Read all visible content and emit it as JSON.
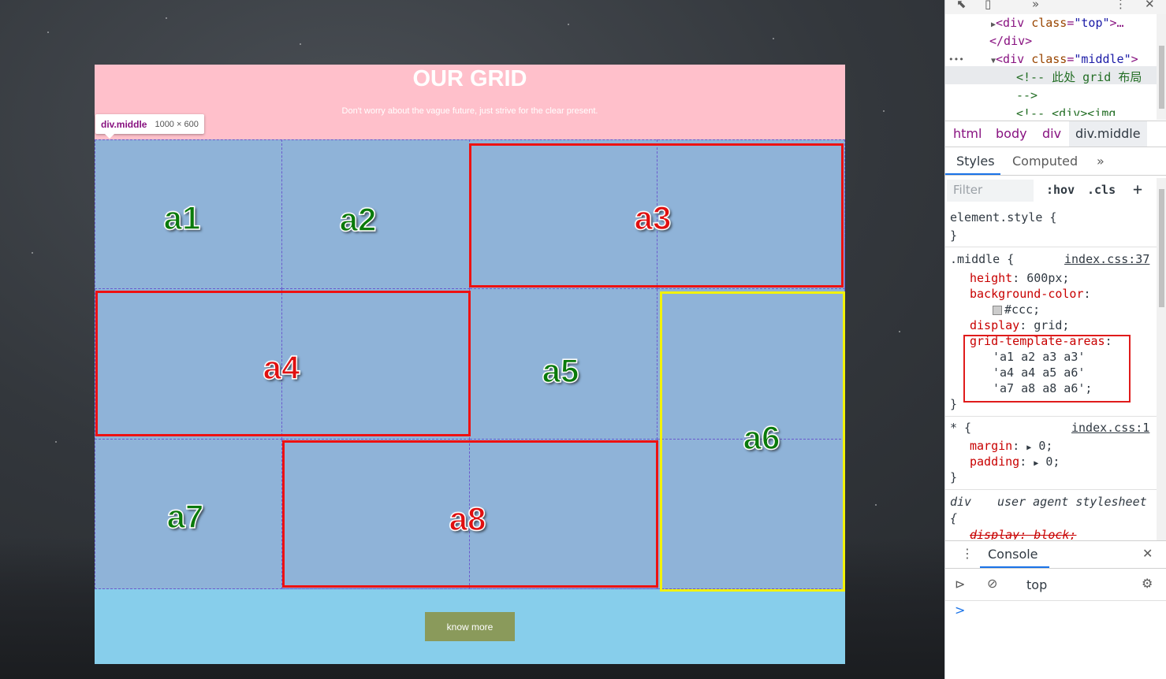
{
  "page": {
    "title": "OUR GRID",
    "subtitle": "Don't worry about the vague future, just strive for the clear present.",
    "button_label": "know more",
    "grid_cells": 12,
    "area_labels": {
      "a1": "a1",
      "a2": "a2",
      "a3": "a3",
      "a4": "a4",
      "a5": "a5",
      "a6": "a6",
      "a7": "a7",
      "a8": "a8"
    },
    "colors": {
      "top": "#ffc0cb",
      "middle": "#8fb3d8",
      "bottom": "#87ceeb",
      "button": "#8a9a5b",
      "label_green": "#0a7a0a",
      "label_red": "#e01010",
      "box_red": "#ee1111",
      "box_yellow": "#f2f20a"
    }
  },
  "tooltip": {
    "tag": "div.middle",
    "dimensions": "1000 × 600"
  },
  "devtools": {
    "toolbar": {
      "more": "»",
      "menu": "⋮",
      "close": "✕"
    },
    "dom": {
      "line1_open": "<div",
      "line1_attr": "class",
      "line1_val": "\"top\"",
      "line1_rest": ">…",
      "line2": "</div>",
      "line3_open": "<div",
      "line3_attr": "class",
      "line3_val": "\"middle\"",
      "line3_rest": ">",
      "line4": "<!-- 此处 grid 布局",
      "line5": "-->",
      "line6": "<!-- <div><img",
      "ellipsis": "•••"
    },
    "breadcrumbs": [
      "html",
      "body",
      "div",
      "div.middle"
    ],
    "tabs": [
      "Styles",
      "Computed",
      "»"
    ],
    "filter": {
      "placeholder": "Filter",
      "hov": ":hov",
      "cls": ".cls",
      "add": "+"
    },
    "rules": {
      "element_style": "element.style {",
      "close_brace": "}",
      "middle_selector": ".middle {",
      "middle_source": "index.css:37",
      "height_prop": "height",
      "height_val": "600px;",
      "bg_prop": "background-color",
      "bg_val": "#ccc;",
      "display_prop": "display",
      "display_val": "grid;",
      "gta_prop": "grid-template-areas",
      "gta_row1": "'a1 a2 a3 a3'",
      "gta_row2": "'a4 a4 a5 a6'",
      "gta_row3": "'a7 a8 a8 a6';",
      "star_selector": "* {",
      "star_source": "index.css:1",
      "margin_prop": "margin",
      "margin_val": "0;",
      "padding_prop": "padding",
      "padding_val": "0;",
      "div_selector": "div",
      "div_source": "user agent stylesheet",
      "div_open": "{",
      "div_display": "display: block;"
    },
    "console": {
      "tab": "Console",
      "context": "top",
      "prompt": ">"
    }
  }
}
